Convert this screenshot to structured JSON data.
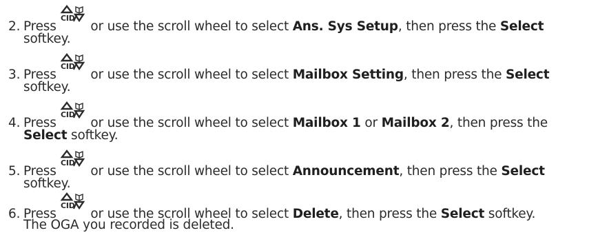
{
  "steps": [
    {
      "number": "2.",
      "press": "Press",
      "after_icon": " or use the scroll wheel to select ",
      "target": "Ans. Sys Setup",
      "mid": ", then press the ",
      "softkey": "Select",
      "line2": "softkey."
    },
    {
      "number": "3.",
      "press": "Press",
      "after_icon": " or use the scroll wheel to select ",
      "target": "Mailbox Setting",
      "mid": ", then press the ",
      "softkey": "Select",
      "line2": "softkey."
    },
    {
      "number": "4.",
      "press": "Press",
      "after_icon": " or use the scroll wheel to select ",
      "target": "Mailbox 1",
      "or": " or ",
      "target2": "Mailbox 2",
      "mid": ", then press the",
      "softkey": "Select",
      "line2": " softkey."
    },
    {
      "number": "5.",
      "press": "Press",
      "after_icon": " or use the scroll wheel to select ",
      "target": "Announcement",
      "mid": ", then press the ",
      "softkey": "Select",
      "line2": "softkey."
    },
    {
      "number": "6.",
      "press": "Press",
      "after_icon": " or use the scroll wheel to select ",
      "target": "Delete",
      "mid": ", then press the ",
      "softkey": "Select",
      "end": " softkey.",
      "line2": "The OGA you recorded is deleted."
    }
  ],
  "icon": {
    "name": "cid-up-down-nav-icon",
    "label": "CID"
  }
}
